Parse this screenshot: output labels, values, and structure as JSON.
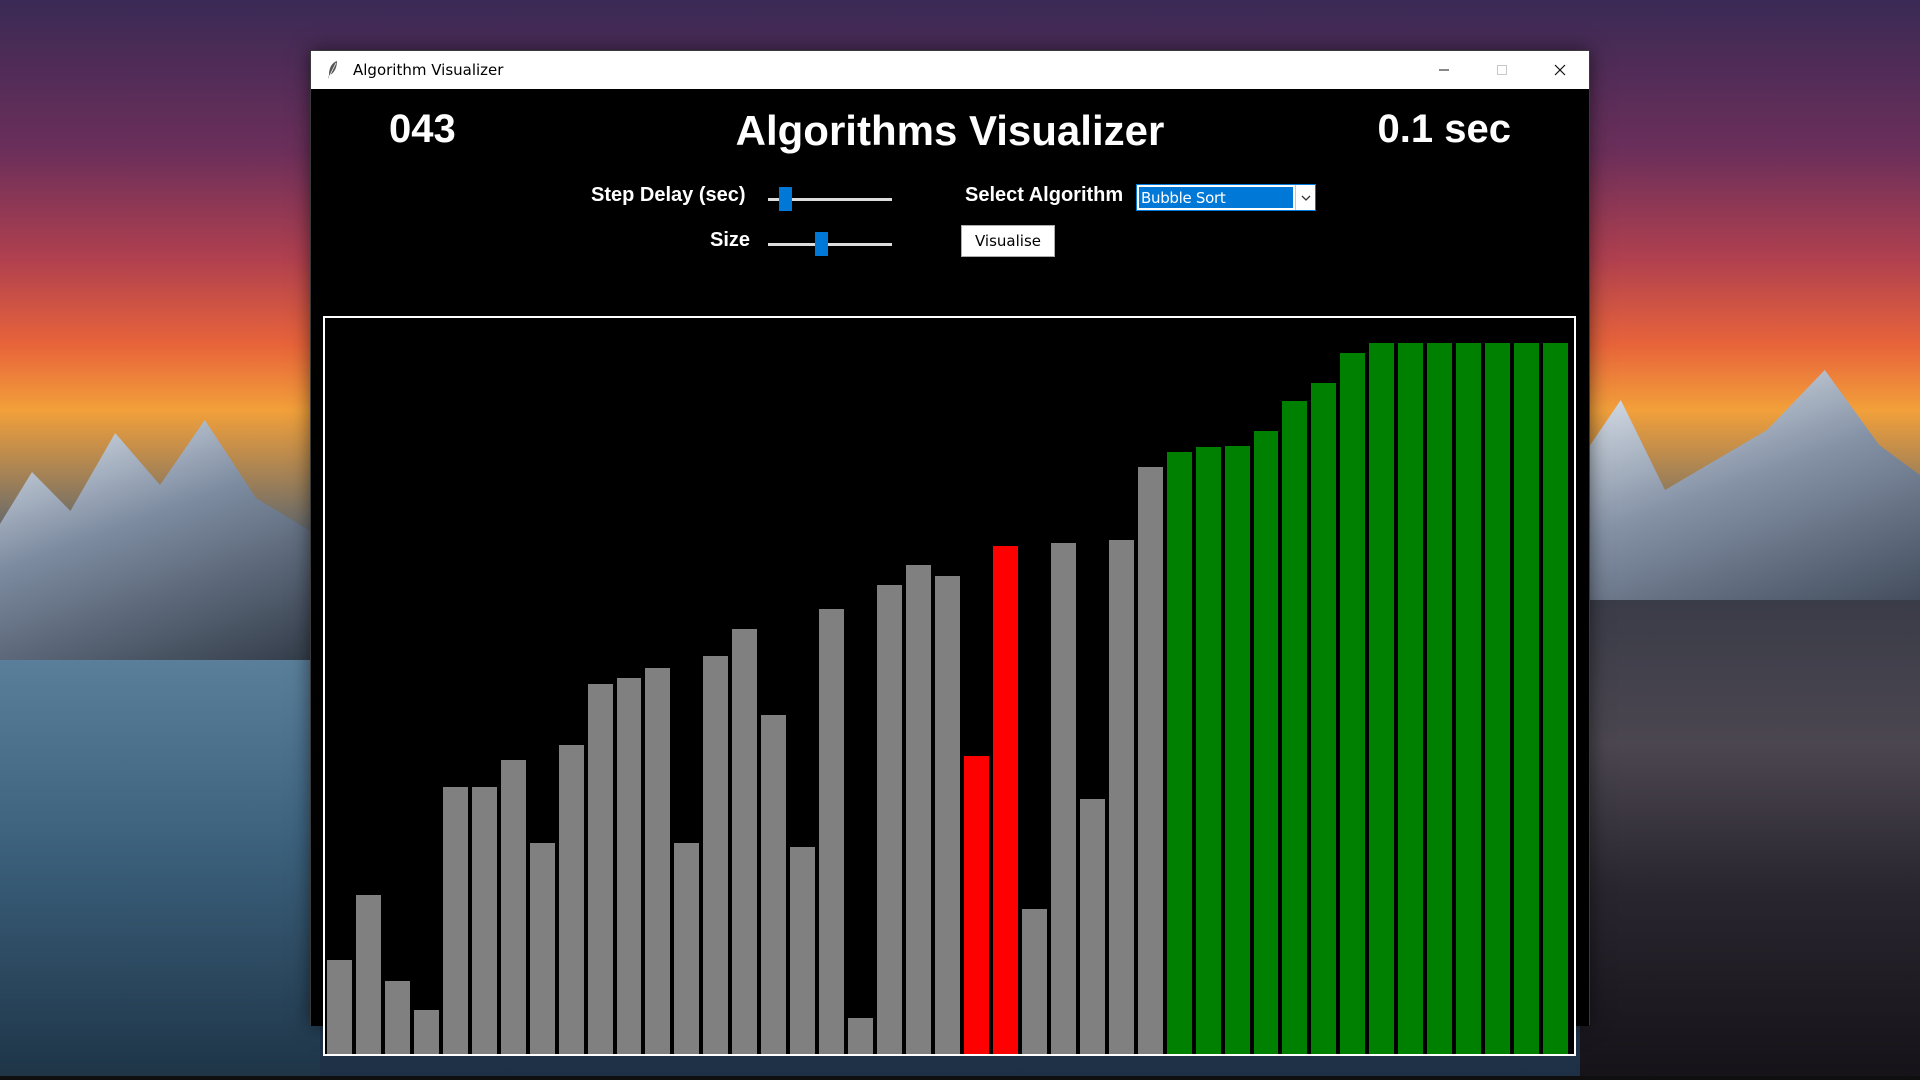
{
  "window": {
    "title": "Algorithm Visualizer",
    "icon": "feather-icon"
  },
  "header": {
    "counter": "043",
    "title": "Algorithms Visualizer",
    "time": "0.1 sec"
  },
  "controls": {
    "step_delay_label": "Step Delay (sec)",
    "step_delay_value": 0.1,
    "size_label": "Size",
    "size_value": 0.42,
    "algorithm_label": "Select Algorithm",
    "algorithm_selected": "Bubble Sort",
    "visualise_label": "Visualise"
  },
  "colors": {
    "default": "#808080",
    "compare": "#ff0000",
    "sorted": "#008000",
    "accent": "#0078d7"
  },
  "chart_data": {
    "type": "bar",
    "values": [
      95,
      160,
      73,
      44,
      268,
      268,
      296,
      212,
      311,
      372,
      378,
      388,
      212,
      400,
      427,
      341,
      208,
      447,
      36,
      472,
      492,
      481,
      300,
      511,
      146,
      514,
      256,
      517,
      590,
      605,
      610,
      611,
      626,
      657,
      675,
      705,
      715,
      715,
      715,
      715,
      715,
      715,
      715
    ],
    "states": [
      "default",
      "default",
      "default",
      "default",
      "default",
      "default",
      "default",
      "default",
      "default",
      "default",
      "default",
      "default",
      "default",
      "default",
      "default",
      "default",
      "default",
      "default",
      "default",
      "default",
      "default",
      "default",
      "compare",
      "compare",
      "default",
      "default",
      "default",
      "default",
      "default",
      "sorted",
      "sorted",
      "sorted",
      "sorted",
      "sorted",
      "sorted",
      "sorted",
      "sorted",
      "sorted",
      "sorted",
      "sorted",
      "sorted",
      "sorted",
      "sorted"
    ],
    "ylim": [
      0,
      740
    ]
  }
}
